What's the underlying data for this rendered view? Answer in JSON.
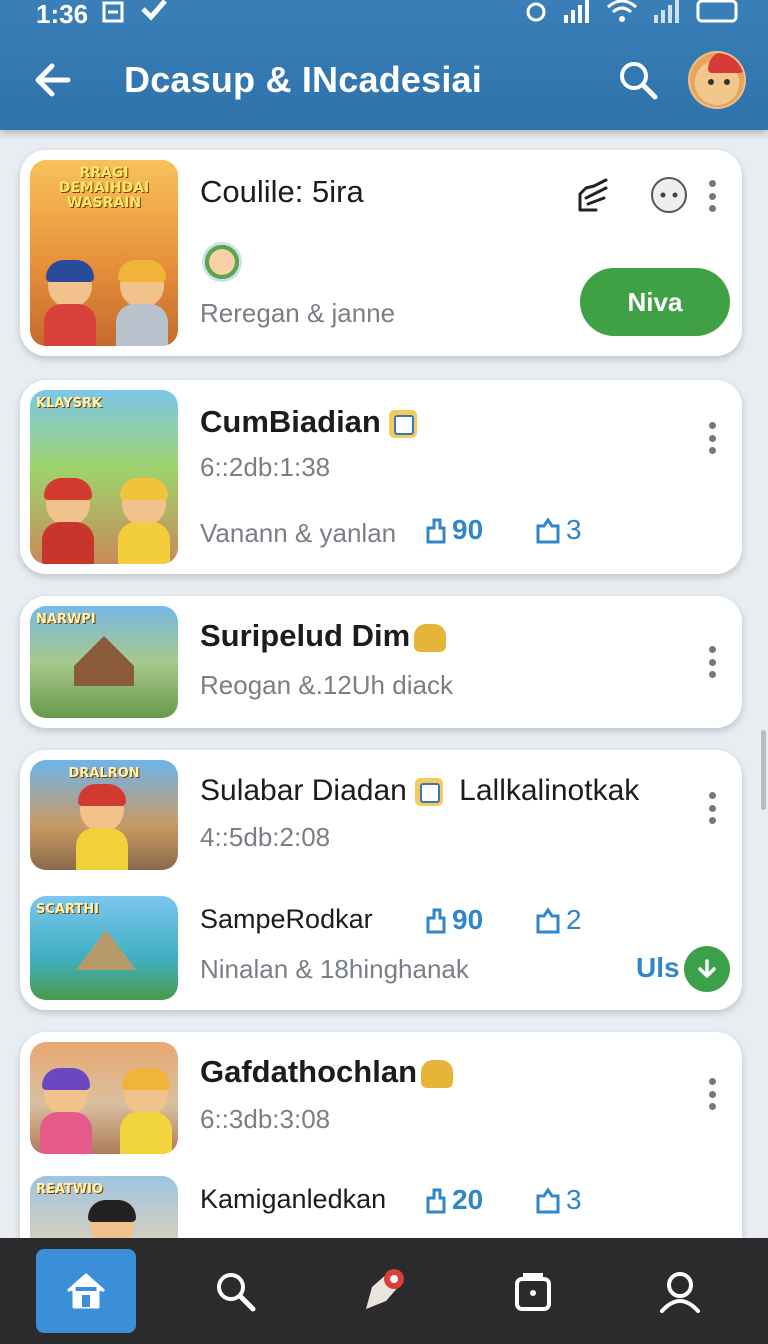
{
  "status_bar": {
    "time": "1:36"
  },
  "header": {
    "title": "Dcasup & INcadesiai"
  },
  "colors": {
    "appbar": "#2f72ab",
    "accent": "#2f86c8",
    "primary_button": "#40a046",
    "nav_background": "#2b2b2d",
    "nav_active": "#3a8fd8"
  },
  "cards": [
    {
      "title": "Coulile: 5ira",
      "subtitle": "Reregan & janne",
      "button_label": "Niva",
      "icons": [
        "hand-pointer-icon",
        "more-circle-icon",
        "kebab-icon"
      ]
    },
    {
      "title": "CumBiadian",
      "time": "6::2db:1:38",
      "subtitle": "Vanann & yanlan",
      "stat_likes": "90",
      "stat_shares": "3"
    },
    {
      "title": "Suripelud Dim",
      "subtitle": "Reogan &.12Uh diack"
    },
    {
      "title": "Sulabar Diadan",
      "title_extra": "Lallkalinotkak",
      "time": "4::5db:2:08",
      "sub_title": "SampeRodkar",
      "stat_likes": "90",
      "stat_shares": "2",
      "subtitle": "Ninalan & 18hinghanak",
      "download_label": "Uls"
    },
    {
      "title": "Gafdathochlan",
      "time": "6::3db:3:08",
      "sub_title": "Kamiganledkan",
      "stat_likes": "20",
      "stat_shares": "3"
    }
  ],
  "thumb_banners": [
    "RRAGI DEMAIHDAI WASRAIN",
    "KLAYSRK",
    "NARWPI",
    "DRALRON",
    "SCARTHI",
    "",
    "REATWIO"
  ],
  "bottom_nav": [
    {
      "name": "home",
      "icon": "home-icon",
      "active": true
    },
    {
      "name": "search",
      "icon": "search-icon",
      "active": false
    },
    {
      "name": "explore",
      "icon": "rocket-icon",
      "active": false
    },
    {
      "name": "bag",
      "icon": "bag-icon",
      "active": false
    },
    {
      "name": "profile",
      "icon": "person-icon",
      "active": false
    }
  ]
}
